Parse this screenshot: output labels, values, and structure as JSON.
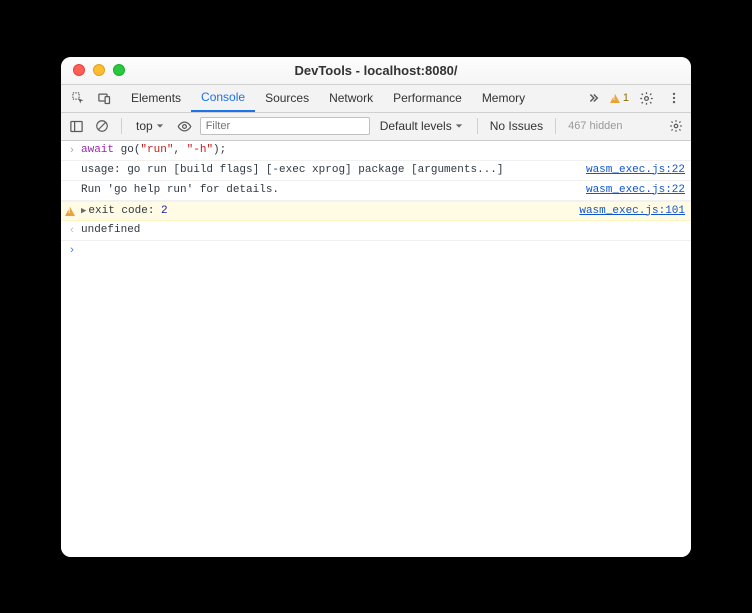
{
  "window": {
    "title": "DevTools - localhost:8080/"
  },
  "tabs": {
    "items": [
      "Elements",
      "Console",
      "Sources",
      "Network",
      "Performance",
      "Memory"
    ],
    "activeIndex": 1
  },
  "warningBadge": {
    "count": "1"
  },
  "toolbar": {
    "contextLabel": "top",
    "filterPlaceholder": "Filter",
    "levelsLabel": "Default levels",
    "issuesLabel": "No Issues",
    "hiddenLabel": "467 hidden"
  },
  "console": {
    "input": {
      "prefix": "await",
      "call": " go(",
      "arg1": "\"run\"",
      "sep": ", ",
      "arg2": "\"-h\"",
      "suffix": ");"
    },
    "log1": {
      "text": "usage: go run [build flags] [-exec xprog] package [arguments...]",
      "sourceFile": "wasm_exec.js",
      "sourceLine": "22"
    },
    "log2": {
      "text": "Run 'go help run' for details.",
      "sourceFile": "wasm_exec.js",
      "sourceLine": "22"
    },
    "warn": {
      "label": "exit code: ",
      "code": "2",
      "sourceFile": "wasm_exec.js",
      "sourceLine": "101"
    },
    "result": {
      "text": "undefined"
    }
  }
}
